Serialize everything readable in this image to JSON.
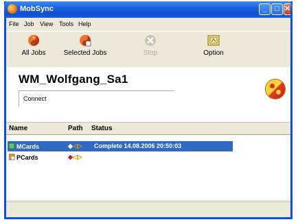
{
  "window": {
    "title": "MobSync"
  },
  "menu": [
    "File",
    "Job",
    "View",
    "Tools",
    "Help"
  ],
  "toolbar": [
    {
      "label": "All Jobs",
      "icon": "all-jobs-icon",
      "enabled": true
    },
    {
      "label": "Selected Jobs",
      "icon": "selected-jobs-icon",
      "enabled": true
    },
    {
      "label": "Stop",
      "icon": "stop-icon",
      "enabled": false
    },
    {
      "label": "Option",
      "icon": "option-icon",
      "enabled": true
    }
  ],
  "job": {
    "name": "WM_Wolfgang_Sa1",
    "status": "Connect"
  },
  "list": {
    "headers": {
      "name": "Name",
      "path": "Path",
      "status": "Status"
    },
    "rows": [
      {
        "name": "MCards",
        "status": "Complete 14.08.2006 20:50:03",
        "selected": true
      },
      {
        "name": "PCards",
        "status": "",
        "selected": false
      }
    ]
  },
  "colors": {
    "titlebar": "#0f4fd2",
    "selection": "#316ac5",
    "frame": "#ece9d8"
  }
}
